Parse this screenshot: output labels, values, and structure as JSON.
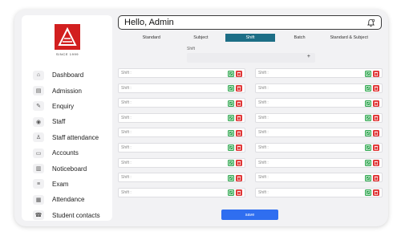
{
  "header": {
    "title": "Hello, Admin",
    "bell_icon": "bell-settings-icon"
  },
  "logo": {
    "text": "SINCE 1999",
    "color": "#d21f1f"
  },
  "sidebar": {
    "items": [
      {
        "label": "Dashboard",
        "icon": "home-icon"
      },
      {
        "label": "Admission",
        "icon": "admission-icon"
      },
      {
        "label": "Enquiry",
        "icon": "enquiry-icon"
      },
      {
        "label": "Staff",
        "icon": "staff-icon"
      },
      {
        "label": "Staff attendance",
        "icon": "staff-attendance-icon"
      },
      {
        "label": "Accounts",
        "icon": "accounts-icon"
      },
      {
        "label": "Noticeboard",
        "icon": "noticeboard-icon"
      },
      {
        "label": "Exam",
        "icon": "exam-icon"
      },
      {
        "label": "Attendance",
        "icon": "attendance-icon"
      },
      {
        "label": "Student contacts",
        "icon": "student-contacts-icon"
      }
    ]
  },
  "tabs": [
    {
      "label": "Standard",
      "active": false
    },
    {
      "label": "Subject",
      "active": false
    },
    {
      "label": "Shift",
      "active": true
    },
    {
      "label": "Batch",
      "active": false
    },
    {
      "label": "Standard & Subject",
      "active": false
    }
  ],
  "shift_selector": {
    "label": "Shift",
    "plus": "+"
  },
  "fields": {
    "left": [
      "Shift :",
      "Shift :",
      "Shift :",
      "Shift :",
      "Shift :",
      "Shift :",
      "Shift :",
      "Shift :",
      "Shift :"
    ],
    "right": [
      "Shift :",
      "Shift :",
      "Shift :",
      "Shift :",
      "Shift :",
      "Shift :",
      "Shift :",
      "Shift :",
      "Shift :"
    ]
  },
  "colors": {
    "accent": "#1d6e86",
    "edit": "#32a852",
    "delete": "#e03434",
    "save": "#2f6ef0"
  },
  "save_label": "save"
}
